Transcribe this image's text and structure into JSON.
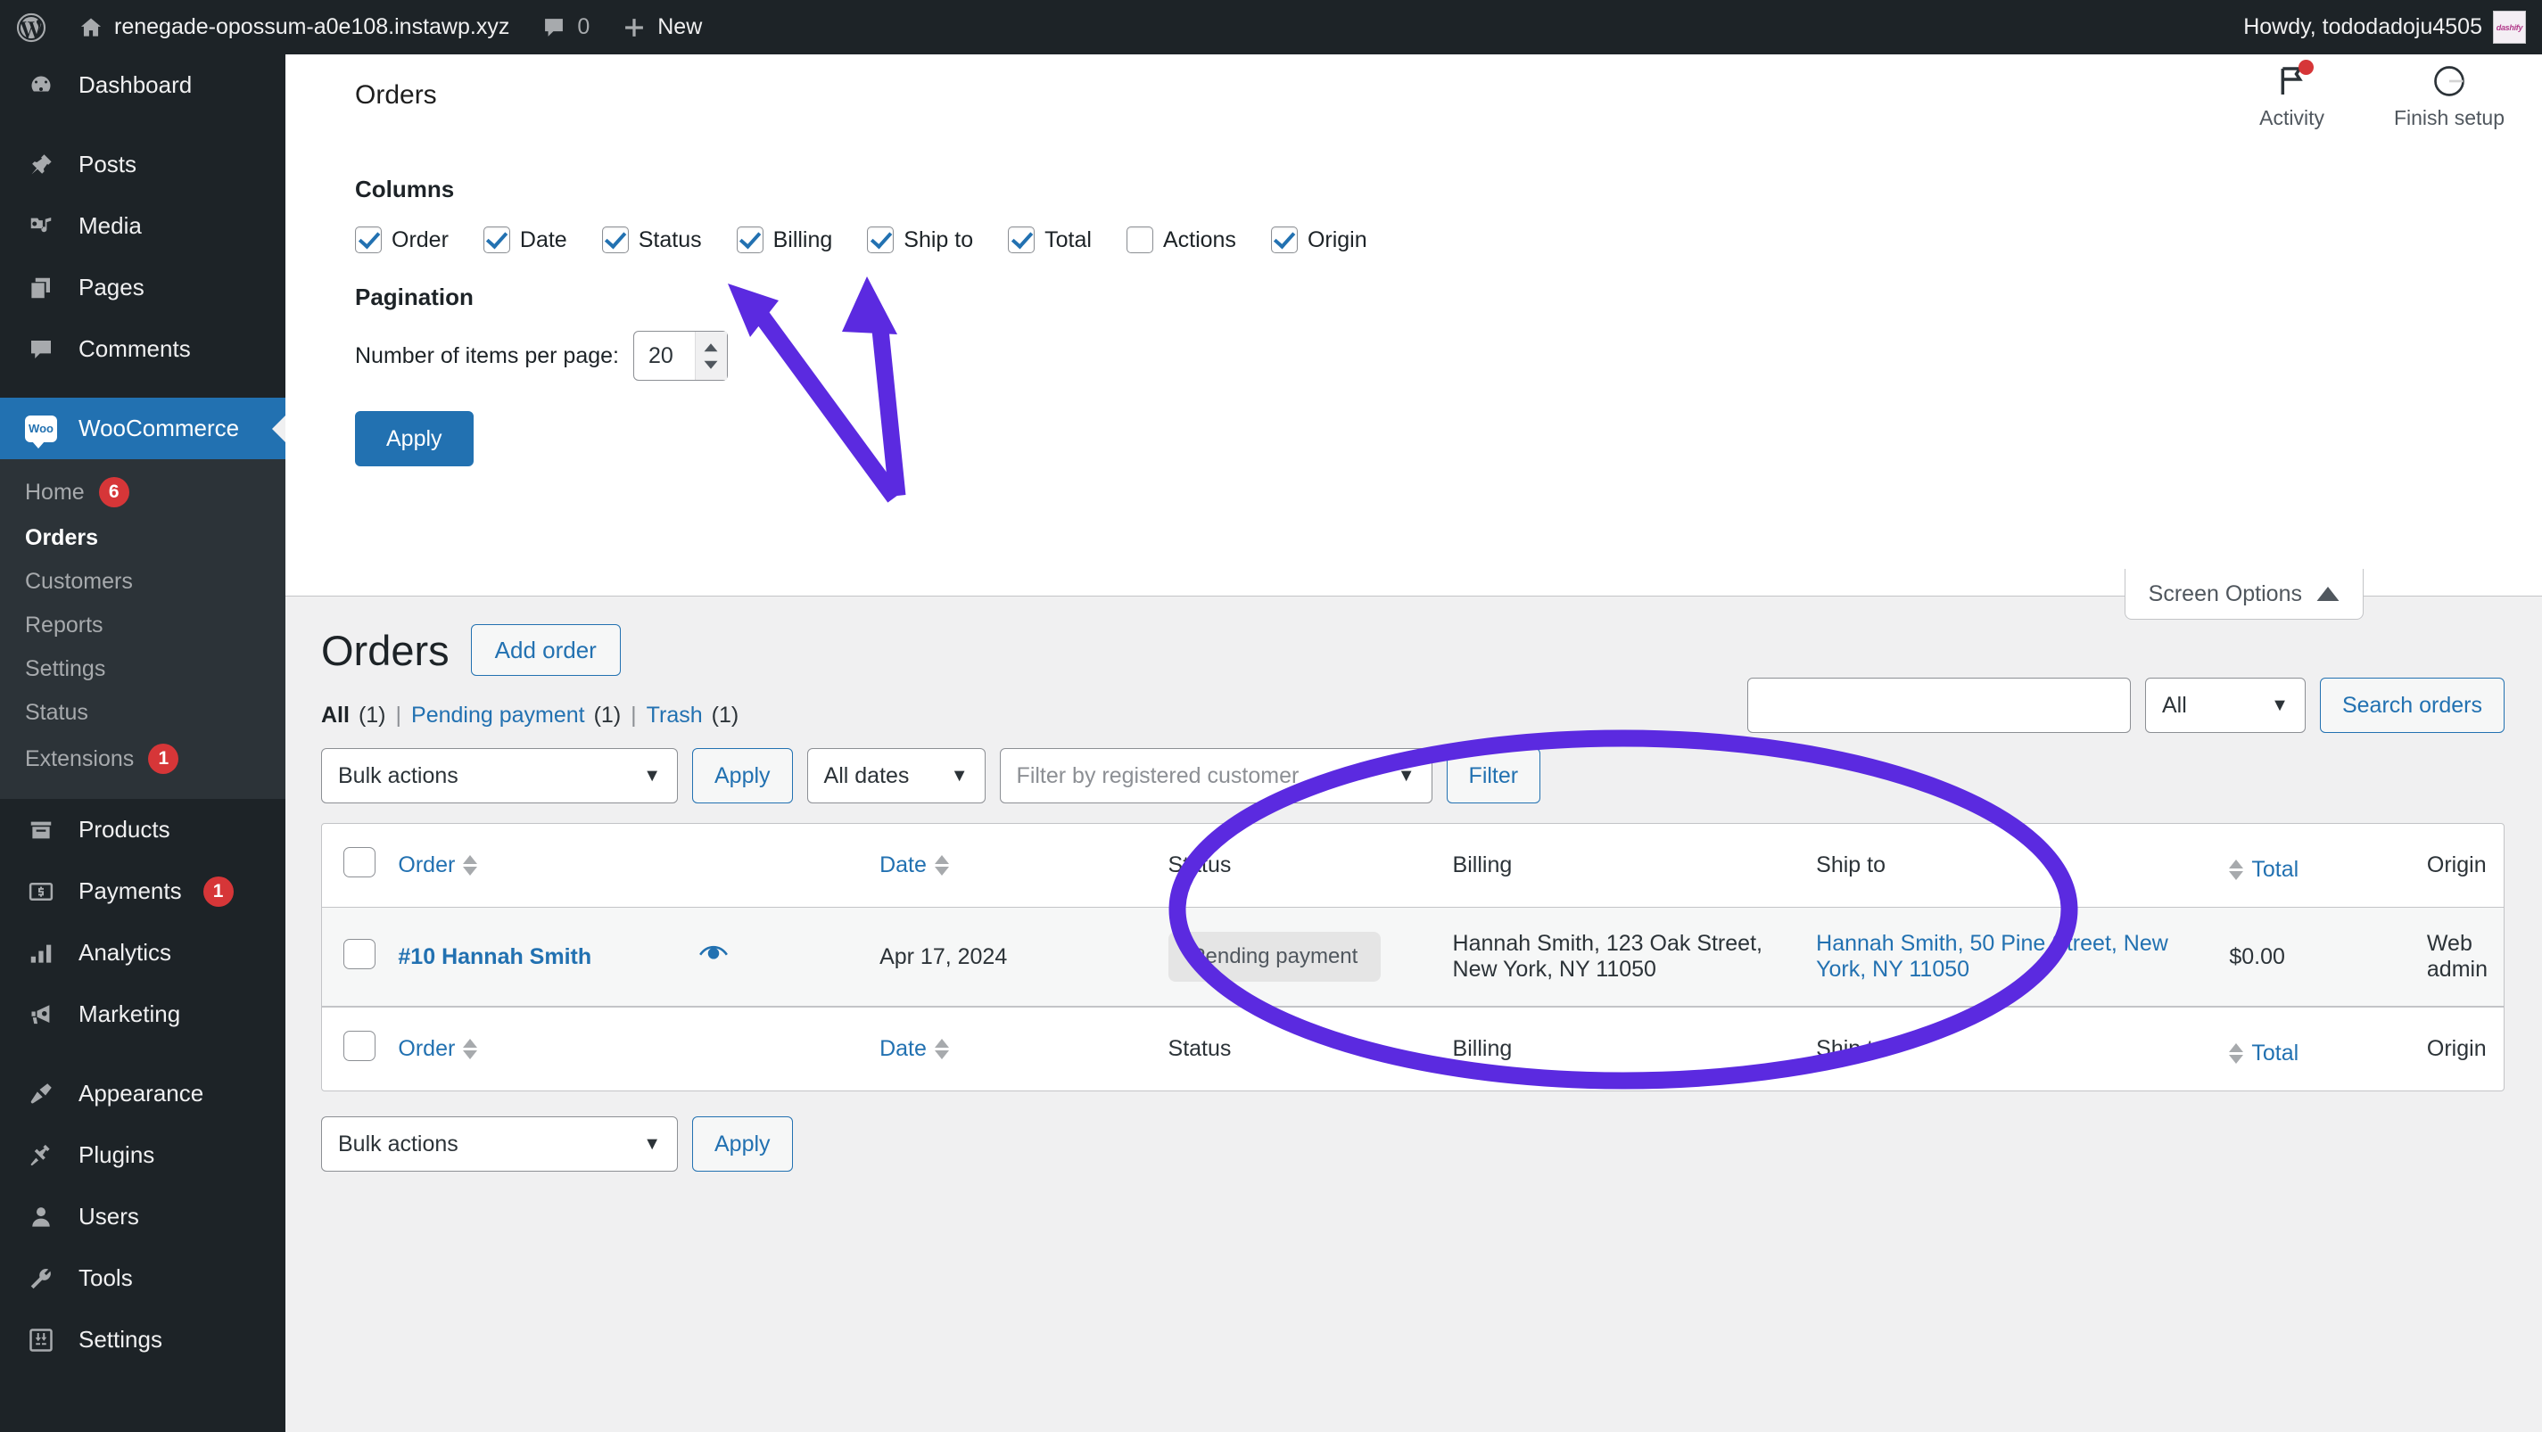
{
  "adminbar": {
    "wp_logo_icon": "wordpress-logo-icon",
    "home_icon": "home-icon",
    "site_name": "renegade-opossum-a0e108.instawp.xyz",
    "comments_icon": "comment-bubble-icon",
    "comments_count": "0",
    "new_icon": "plus-icon",
    "new_label": "New",
    "howdy": "Howdy, tododadoju4505",
    "avatar_text": "dashify"
  },
  "sidebar": {
    "items": [
      {
        "label": "Dashboard",
        "icon": "dashboard-icon"
      },
      {
        "label": "Posts",
        "icon": "pin-icon"
      },
      {
        "label": "Media",
        "icon": "media-icon"
      },
      {
        "label": "Pages",
        "icon": "pages-icon"
      },
      {
        "label": "Comments",
        "icon": "comments-icon"
      },
      {
        "label": "WooCommerce",
        "icon": "woo-icon",
        "current": true
      },
      {
        "label": "Products",
        "icon": "products-box-icon"
      },
      {
        "label": "Payments",
        "icon": "payments-card-icon",
        "badge": "1"
      },
      {
        "label": "Analytics",
        "icon": "bar-chart-icon"
      },
      {
        "label": "Marketing",
        "icon": "megaphone-icon"
      },
      {
        "label": "Appearance",
        "icon": "paintbrush-icon"
      },
      {
        "label": "Plugins",
        "icon": "plug-icon"
      },
      {
        "label": "Users",
        "icon": "user-icon"
      },
      {
        "label": "Tools",
        "icon": "wrench-icon"
      },
      {
        "label": "Settings",
        "icon": "sliders-icon"
      }
    ],
    "woo_submenu": [
      {
        "label": "Home",
        "badge": "6"
      },
      {
        "label": "Orders",
        "active": true
      },
      {
        "label": "Customers"
      },
      {
        "label": "Reports"
      },
      {
        "label": "Settings"
      },
      {
        "label": "Status"
      },
      {
        "label": "Extensions",
        "badge": "1"
      }
    ]
  },
  "woo_header": {
    "title": "Orders",
    "activity_label": "Activity",
    "activity_icon": "flag-icon",
    "activity_has_notification": true,
    "finish_setup_label": "Finish setup",
    "finish_setup_icon": "progress-circle-icon"
  },
  "screen_options": {
    "tab_label": "Screen Options",
    "tab_chevron": "chevron-up-icon",
    "columns_heading": "Columns",
    "columns": [
      {
        "label": "Order",
        "checked": true
      },
      {
        "label": "Date",
        "checked": true
      },
      {
        "label": "Status",
        "checked": true
      },
      {
        "label": "Billing",
        "checked": true
      },
      {
        "label": "Ship to",
        "checked": true
      },
      {
        "label": "Total",
        "checked": true
      },
      {
        "label": "Actions",
        "checked": false
      },
      {
        "label": "Origin",
        "checked": true
      }
    ],
    "pagination_heading": "Pagination",
    "items_per_page_label": "Number of items per page:",
    "items_per_page_value": "20",
    "apply_label": "Apply"
  },
  "list_page": {
    "title": "Orders",
    "add_order_label": "Add order",
    "views": [
      {
        "label": "All",
        "count": "(1)",
        "current": true
      },
      {
        "label": "Pending payment",
        "count": "(1)"
      },
      {
        "label": "Trash",
        "count": "(1)"
      }
    ],
    "view_separator": "|",
    "bulk_actions_label": "Bulk actions",
    "apply_label": "Apply",
    "date_filter_label": "All dates",
    "customer_filter_placeholder": "Filter by registered customer",
    "filter_label": "Filter",
    "search_value": "",
    "search_scope_label": "All",
    "search_button_label": "Search orders",
    "columns": [
      "Order",
      "Date",
      "Status",
      "Billing",
      "Ship to",
      "Total",
      "Origin"
    ],
    "rows": [
      {
        "order": "#10 Hannah Smith",
        "preview_icon": "eye-icon",
        "date": "Apr 17, 2024",
        "status": "Pending payment",
        "billing": "Hannah Smith, 123 Oak Street, New York, NY 11050",
        "ship_to": "Hannah Smith, 50 Pine Street, New York, NY 11050",
        "total": "$0.00",
        "origin": "Web admin"
      }
    ],
    "bottom_bulk_actions_label": "Bulk actions",
    "bottom_apply_label": "Apply"
  },
  "annotations": {
    "color": "#5b2ae0",
    "arrow_to_billing": "arrow-pointing-to-billing-column-checkbox",
    "arrow_to_shipto": "arrow-pointing-to-ship-to-column-checkbox",
    "ellipse": "ellipse-highlighting-billing-and-ship-to-columns"
  },
  "colors": {
    "admin_dark": "#1d2327",
    "admin_submenu": "#2c3338",
    "accent_blue": "#2271b1",
    "badge_red": "#d63638",
    "annotation_purple": "#5b2ae0"
  }
}
